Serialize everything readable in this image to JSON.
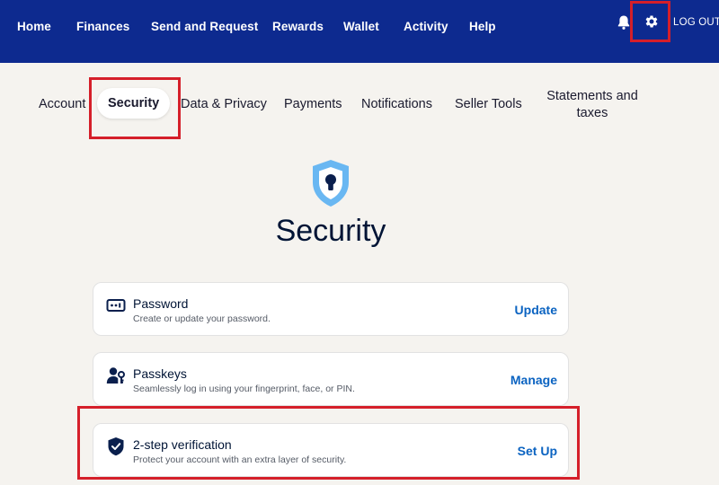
{
  "topnav": {
    "items": [
      "Home",
      "Finances",
      "Send and Request",
      "Rewards",
      "Wallet",
      "Activity",
      "Help"
    ],
    "notifications_icon": "bell-icon",
    "settings_icon": "gear-icon",
    "logout_label": "LOG OUT",
    "background": "#0d2a8f"
  },
  "tabs": [
    {
      "label": "Account",
      "active": false
    },
    {
      "label": "Security",
      "active": true
    },
    {
      "label": "Data & Privacy",
      "active": false
    },
    {
      "label": "Payments",
      "active": false
    },
    {
      "label": "Notifications",
      "active": false
    },
    {
      "label": "Seller Tools",
      "active": false
    },
    {
      "label": "Statements and taxes",
      "active": false
    }
  ],
  "page": {
    "icon": "shield-keyhole-icon",
    "title": "Security"
  },
  "cards": [
    {
      "icon": "password-icon",
      "title": "Password",
      "description": "Create or update your password.",
      "action": "Update"
    },
    {
      "icon": "passkey-icon",
      "title": "Passkeys",
      "description": "Seamlessly log in using your fingerprint, face, or PIN.",
      "action": "Manage"
    },
    {
      "icon": "shield-check-icon",
      "title": "2-step verification",
      "description": "Protect your account with an extra layer of security.",
      "action": "Set Up"
    }
  ],
  "colors": {
    "accent": "#0b63c1",
    "highlight": "#d51f2a",
    "page_background": "#f5f3ef"
  }
}
